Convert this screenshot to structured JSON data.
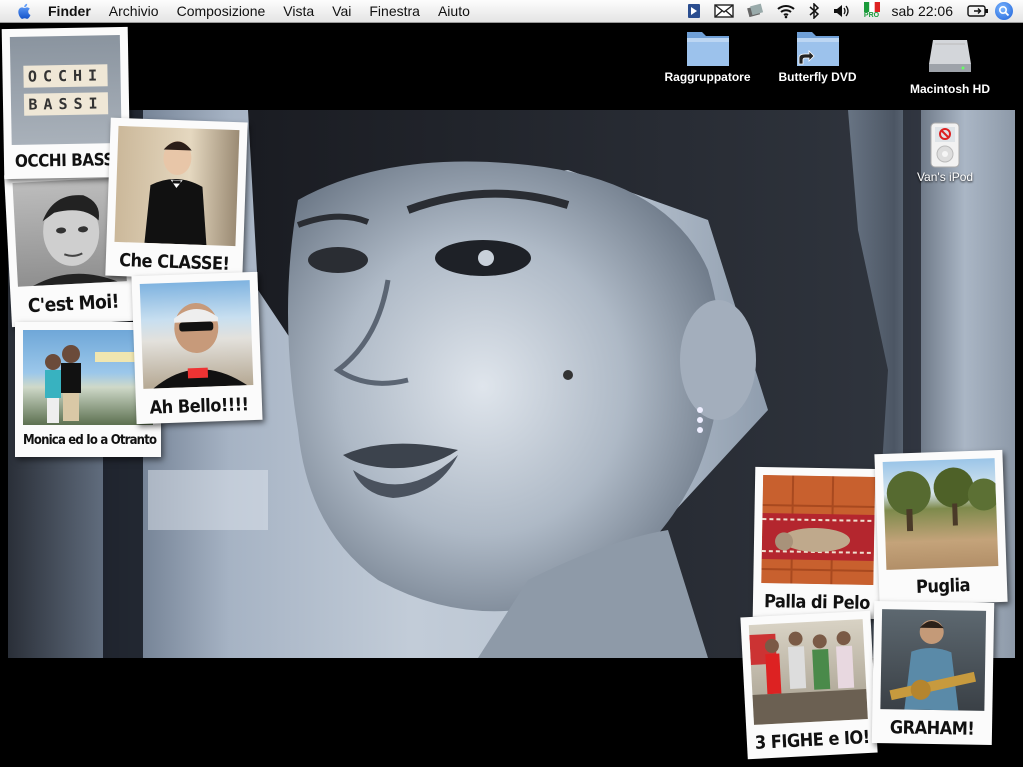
{
  "menubar": {
    "app": "Finder",
    "items": [
      "Archivio",
      "Composizione",
      "Vista",
      "Vai",
      "Finestra",
      "Aiuto"
    ],
    "clock": "sab 22:06",
    "flag_badge": "PRO"
  },
  "desktop_icons": {
    "raggruppatore": "Raggruppatore",
    "butterfly": "Butterfly DVD",
    "macintosh": "Macintosh HD",
    "ipod": "Van's iPod"
  },
  "polaroids": {
    "occhi": "OCCHI BASSI",
    "occhi_letters_top": "OCCHI",
    "occhi_letters_bottom": "BASSI",
    "classe": "Che CLASSE!",
    "moi": "C'est Moi!",
    "otranto": "Monica ed Io a Otranto",
    "bello": "Ah Bello!!!!",
    "palla": "Palla di Pelo",
    "puglia": "Puglia",
    "fighe": "3 FIGHE e IO!",
    "graham": "GRAHAM!"
  }
}
